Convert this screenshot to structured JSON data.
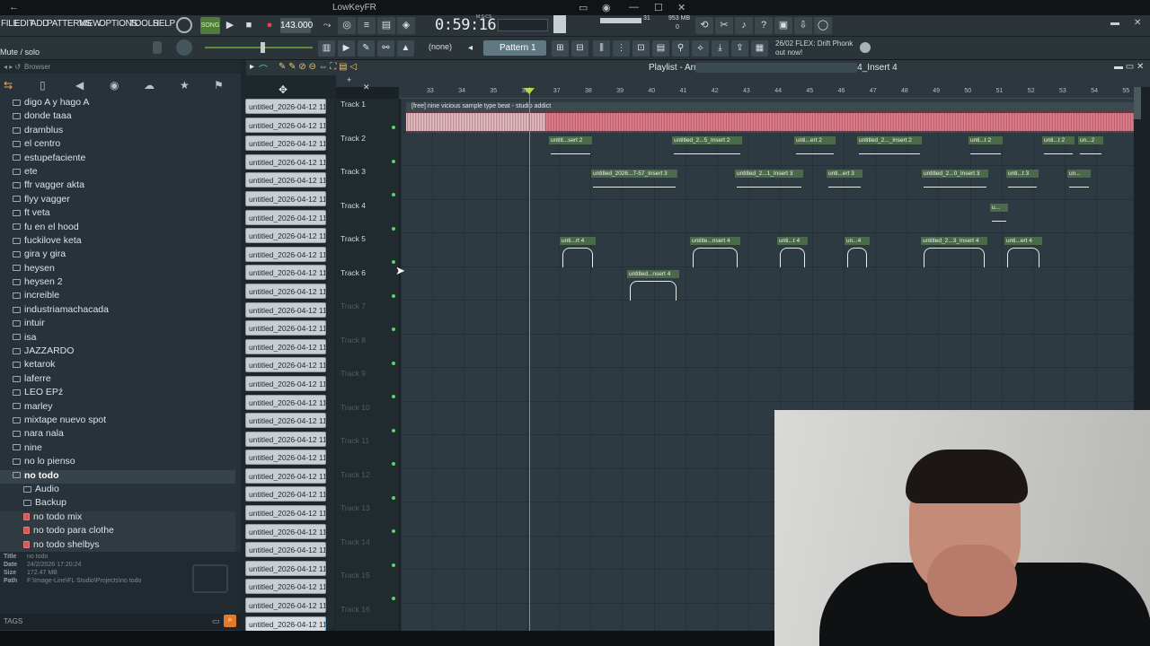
{
  "window": {
    "title": "LowKeyFR"
  },
  "menu": [
    "FILE",
    "EDIT",
    "ADD",
    "PATTERNS",
    "VIEW",
    "OPTIONS",
    "TOOLS",
    "HELP"
  ],
  "transport": {
    "song_label": "SONG",
    "bpm": "143.000",
    "time": "0:59:16",
    "time_suffix": "M:S:CS",
    "cpu": "31",
    "mem": "953 MB",
    "voices": "0"
  },
  "toolbar": {
    "mode_text": "Mute / solo",
    "none_label": "(none)",
    "pattern": "Pattern 1",
    "hint": "26/02 FLEX: Drift Phonk out now!"
  },
  "browser": {
    "title": "Browser",
    "items": [
      {
        "label": "digo A y hago A",
        "type": "folder"
      },
      {
        "label": "donde taaa",
        "type": "folder"
      },
      {
        "label": "dramblus",
        "type": "folder"
      },
      {
        "label": "el centro",
        "type": "folder"
      },
      {
        "label": "estupefaciente",
        "type": "folder"
      },
      {
        "label": "ete",
        "type": "folder"
      },
      {
        "label": "ffr vagger akta",
        "type": "folder"
      },
      {
        "label": "flyy vagger",
        "type": "folder"
      },
      {
        "label": "ft veta",
        "type": "folder"
      },
      {
        "label": "fu en el hood",
        "type": "folder"
      },
      {
        "label": "fuckilove keta",
        "type": "folder"
      },
      {
        "label": "gira y gira",
        "type": "folder"
      },
      {
        "label": "heysen",
        "type": "folder"
      },
      {
        "label": "heysen 2",
        "type": "folder"
      },
      {
        "label": "increible",
        "type": "folder"
      },
      {
        "label": "industriamachacada",
        "type": "folder"
      },
      {
        "label": "intuir",
        "type": "folder"
      },
      {
        "label": "isa",
        "type": "folder"
      },
      {
        "label": "JAZZARDO",
        "type": "folder"
      },
      {
        "label": "ketarok",
        "type": "folder"
      },
      {
        "label": "laferre",
        "type": "folder"
      },
      {
        "label": "LEO EPź",
        "type": "folder"
      },
      {
        "label": "marley",
        "type": "folder"
      },
      {
        "label": "mixtape nuevo spot",
        "type": "folder"
      },
      {
        "label": "nara nala",
        "type": "folder"
      },
      {
        "label": "nine",
        "type": "folder"
      },
      {
        "label": "no lo pienso",
        "type": "folder"
      },
      {
        "label": "no todo",
        "type": "selected"
      },
      {
        "label": "Audio",
        "type": "sub"
      },
      {
        "label": "Backup",
        "type": "sub"
      },
      {
        "label": "no todo mix",
        "type": "file"
      },
      {
        "label": "no todo para clothe",
        "type": "file"
      },
      {
        "label": "no todo shelbys",
        "type": "file"
      }
    ],
    "info": {
      "title_label": "Title",
      "title": "no todo",
      "date_label": "Date",
      "date": "24/2/2026 17:20:24",
      "size_label": "Size",
      "size": "172.47 MB",
      "path_label": "Path",
      "path": "F:\\Image-Line\\FL Studio\\Projects\\no todo"
    },
    "tags_label": "TAGS"
  },
  "channels": {
    "label": "untitled_2026-04-12 11-",
    "count": 29
  },
  "playlist": {
    "title": "Playlist - Arrangement › untitled_2026-04-12 11-26-44_Insert 4",
    "bars": [
      "33",
      "34",
      "35",
      "36",
      "37",
      "38",
      "39",
      "40",
      "41",
      "42",
      "43",
      "44",
      "45",
      "46",
      "47",
      "48",
      "49",
      "50",
      "51",
      "52",
      "53",
      "54",
      "55"
    ],
    "tracks": [
      "Track 1",
      "Track 2",
      "Track 3",
      "Track 4",
      "Track 5",
      "Track 6",
      "Track 7",
      "Track 8",
      "Track 9",
      "Track 10",
      "Track 11",
      "Track 12",
      "Track 13",
      "Track 14",
      "Track 15",
      "Track 16"
    ],
    "sample_clip": "[free] nine vicious sample type beat - studio addict",
    "clips": {
      "t2": [
        "untitl...sert 2",
        "untitled_2...5_Insert 2",
        "unti...ert 2",
        "untitled_2..._Insert 2",
        "unti...t 2",
        "unti...t 2",
        "un...2"
      ],
      "t3": [
        "untitled_2026...7-57_Insert 3",
        "untitled_2...1_Insert 3",
        "unti...ert 3",
        "untitled_2...0_Insert 3",
        "unti...t 3",
        "un..."
      ],
      "t4": [
        "u..."
      ],
      "t5": [
        "unti...rt 4",
        "untitle...nsert 4",
        "unti...t 4",
        "un...4",
        "untitled_2...3_Insert 4",
        "unti...ert 4"
      ],
      "t6": [
        "untitled...nsert 4"
      ]
    }
  },
  "colors": {
    "accent": "#b6d84d",
    "waveform": "#c95a68",
    "clip_header": "#4b6a4a"
  }
}
